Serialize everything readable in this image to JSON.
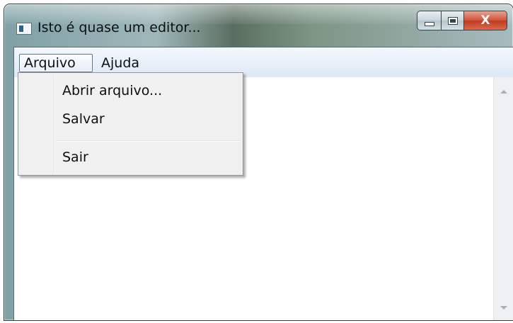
{
  "window": {
    "title": "Isto é quase um editor..."
  },
  "caption_buttons": {
    "close_label": "X"
  },
  "menu_bar": {
    "items": [
      {
        "label": "Arquivo"
      },
      {
        "label": "Ajuda"
      }
    ]
  },
  "dropdown": {
    "items": [
      {
        "label": "Abrir arquivo..."
      },
      {
        "label": "Salvar"
      },
      {
        "label": "Sair"
      }
    ]
  },
  "icons": [
    "app-icon",
    "minimize-icon",
    "maximize-icon",
    "close-icon",
    "scroll-up-arrow-icon",
    "scroll-down-arrow-icon"
  ],
  "colors": {
    "menu_bar": "#dde8f6",
    "close_button": "#c03a22",
    "dropdown_bg": "#f0f0f0"
  }
}
